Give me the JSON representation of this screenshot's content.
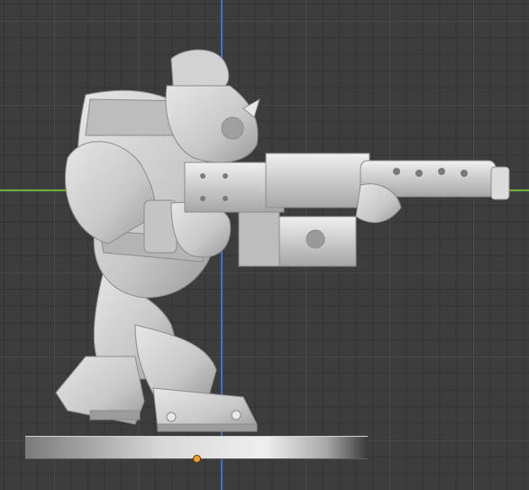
{
  "viewport": {
    "background": "#3d3d3d",
    "axis_x_color": "#6fae3e",
    "axis_y_color": "#3f73c8",
    "origin_marker_color": "#f0a030"
  },
  "model": {
    "icon": "ork-gunner-miniature-icon",
    "material_color": "#cfcfcf"
  }
}
